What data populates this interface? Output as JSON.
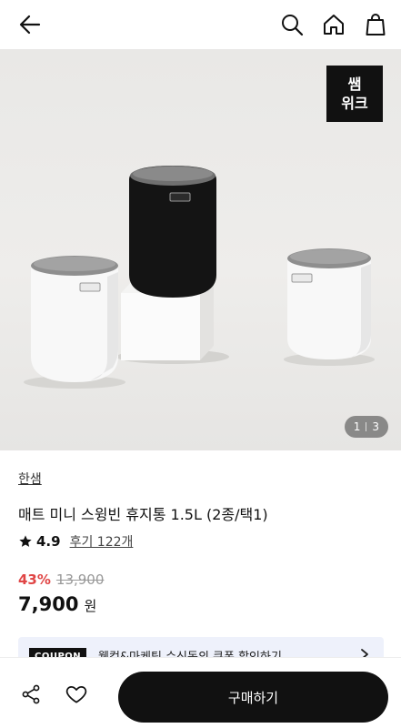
{
  "header": {
    "back_icon": "arrow-left-icon",
    "search_icon": "search-icon",
    "home_icon": "home-icon",
    "cart_icon": "shopping-bag-icon"
  },
  "hero": {
    "badge_line1": "쌤",
    "badge_line2": "위크",
    "pager_current": "1",
    "pager_total": "3",
    "image_count": 3
  },
  "product": {
    "brand": "한샘",
    "title": "매트 미니 스윙빈 휴지통 1.5L (2종/택1)",
    "rating": "4.9",
    "reviews_label": "후기 122개",
    "discount": "43%",
    "original_price": "13,900",
    "final_price": "7,900",
    "currency": "원"
  },
  "coupon": {
    "tag": "COUPON",
    "text": "웰컴&마케팅 수신동의 쿠폰 할인하기"
  },
  "bottom_bar": {
    "share_icon": "share-icon",
    "like_icon": "heart-icon",
    "buy_label": "구매하기"
  },
  "colors": {
    "accent_discount": "#e04545",
    "buy_button": "#111111",
    "coupon_bg": "#eef1fb"
  }
}
